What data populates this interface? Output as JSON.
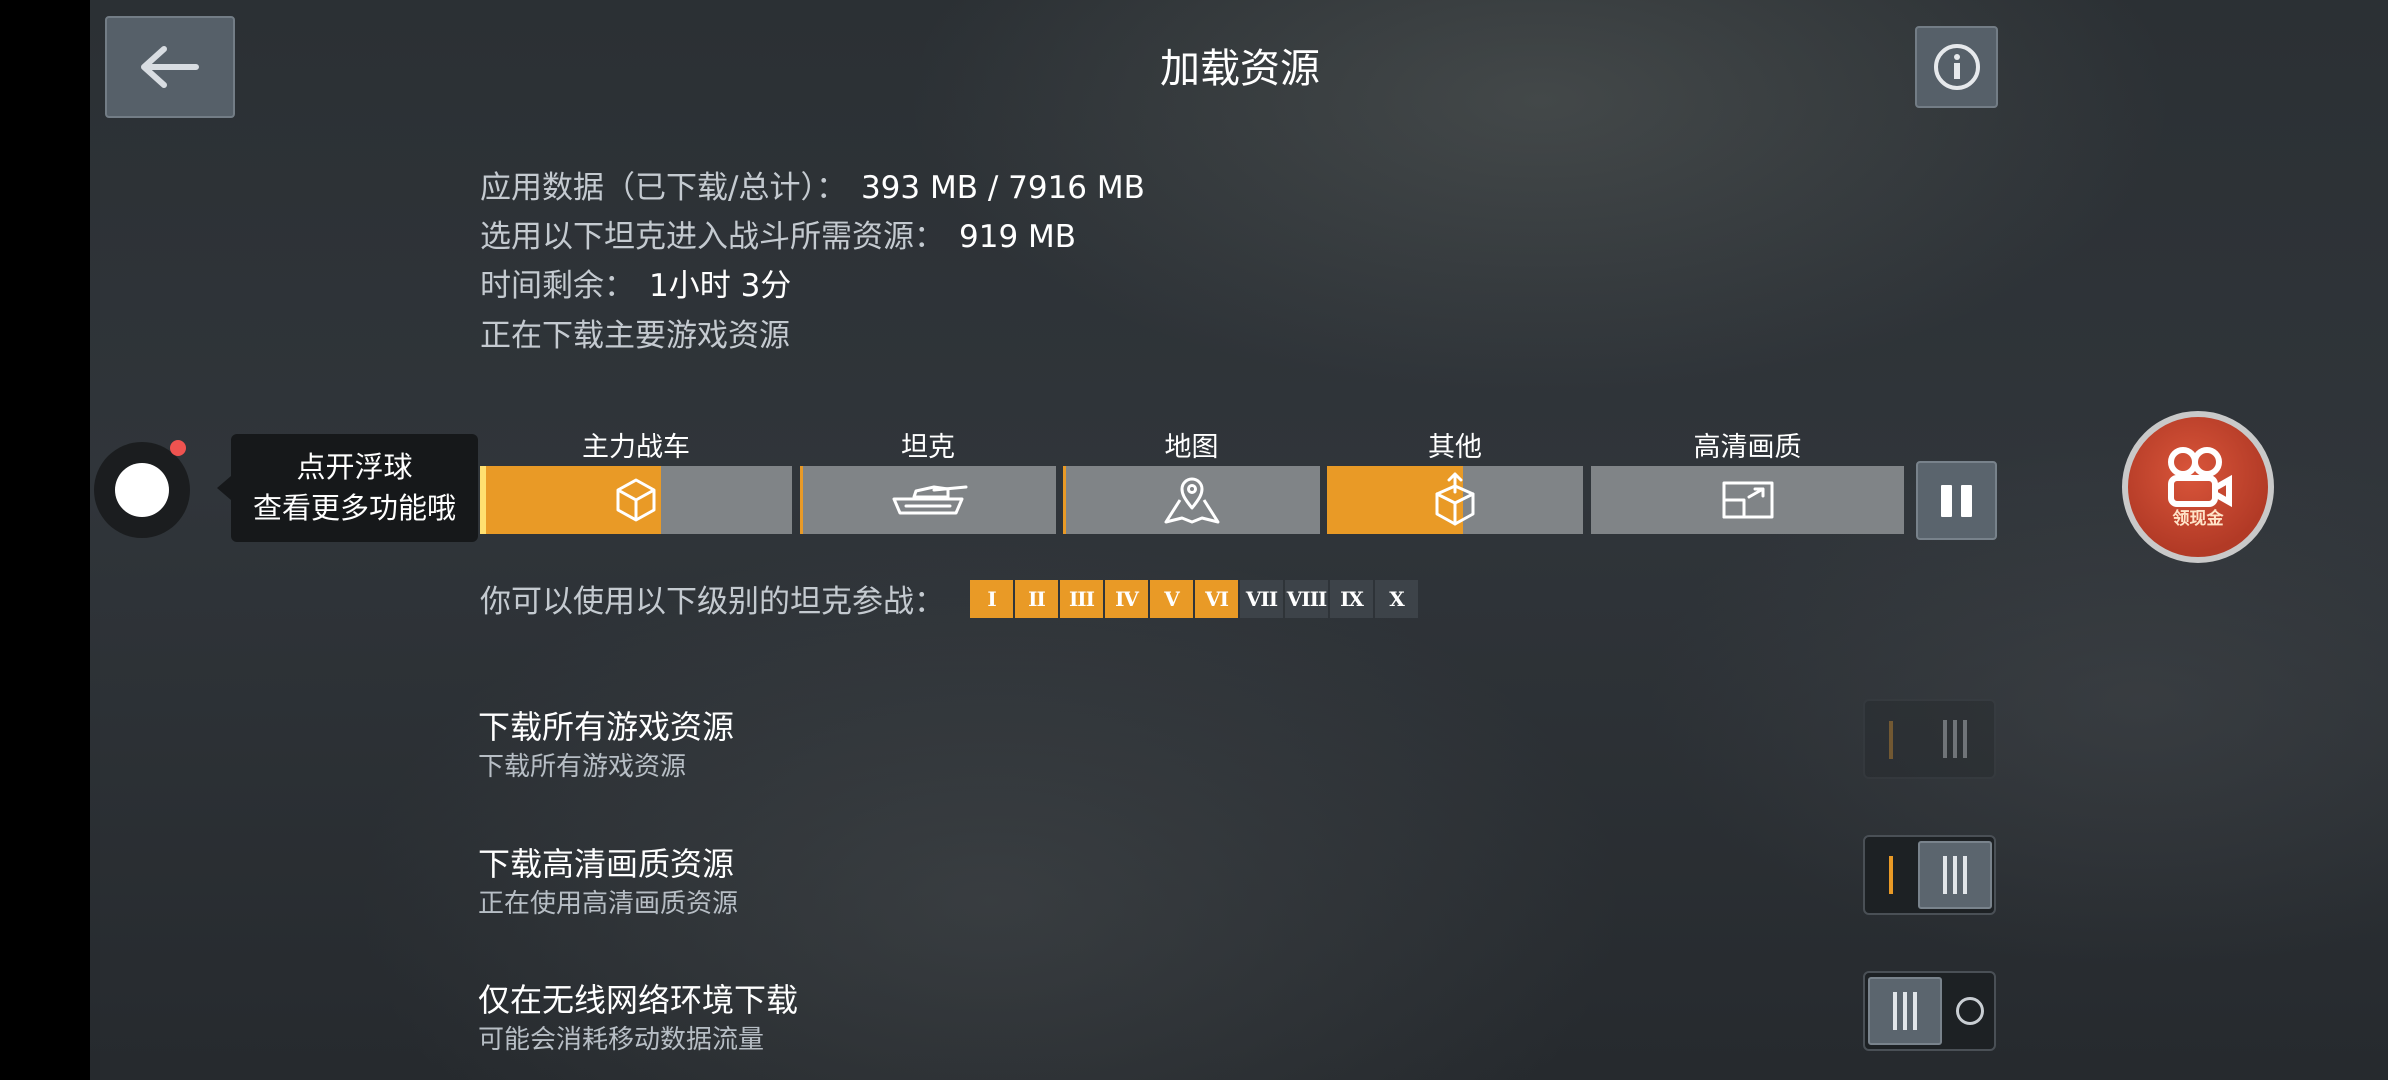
{
  "header": {
    "title": "加载资源",
    "back_icon": "arrow-left-icon",
    "info_icon": "info-icon"
  },
  "info": {
    "app_data_label": "应用数据（已下载/总计）：",
    "app_data_value": "393 MB / 7916 MB",
    "battle_label": "选用以下坦克进入战斗所需资源：",
    "battle_value": "919 MB",
    "time_label": "时间剩余：",
    "time_value": "1小时 3分",
    "status": "正在下载主要游戏资源"
  },
  "float_ball": {
    "tip_line1": "点开浮球",
    "tip_line2": "查看更多功能哦"
  },
  "categories": [
    {
      "label": "主力战车",
      "icon": "cube-icon",
      "progress": 0.58
    },
    {
      "label": "坦克",
      "icon": "tank-icon",
      "progress": 0.01
    },
    {
      "label": "地图",
      "icon": "map-pin-icon",
      "progress": 0.01
    },
    {
      "label": "其他",
      "icon": "box-upload-icon",
      "progress": 0.53
    },
    {
      "label": "高清画质",
      "icon": "hd-resize-icon",
      "progress": 0
    }
  ],
  "pause_icon": "pause-icon",
  "gift": {
    "label": "领现金",
    "icon": "camera-reel-icon"
  },
  "tiers": {
    "label": "你可以使用以下级别的坦克参战：",
    "items": [
      {
        "name": "I",
        "on": true
      },
      {
        "name": "II",
        "on": true
      },
      {
        "name": "III",
        "on": true
      },
      {
        "name": "IV",
        "on": true
      },
      {
        "name": "V",
        "on": true
      },
      {
        "name": "VI",
        "on": true
      },
      {
        "name": "VII",
        "on": false
      },
      {
        "name": "VIII",
        "on": false
      },
      {
        "name": "IX",
        "on": false
      },
      {
        "name": "X",
        "on": false
      }
    ]
  },
  "settings": [
    {
      "title": "下载所有游戏资源",
      "subtitle": "下载所有游戏资源",
      "state": "disabled"
    },
    {
      "title": "下载高清画质资源",
      "subtitle": "正在使用高清画质资源",
      "state": "on"
    },
    {
      "title": "仅在无线网络环境下载",
      "subtitle": "可能会消耗移动数据流量",
      "state": "off"
    }
  ],
  "colors": {
    "accent": "#e99a26",
    "progress_track": "#808487",
    "button_bg": "#566069"
  }
}
